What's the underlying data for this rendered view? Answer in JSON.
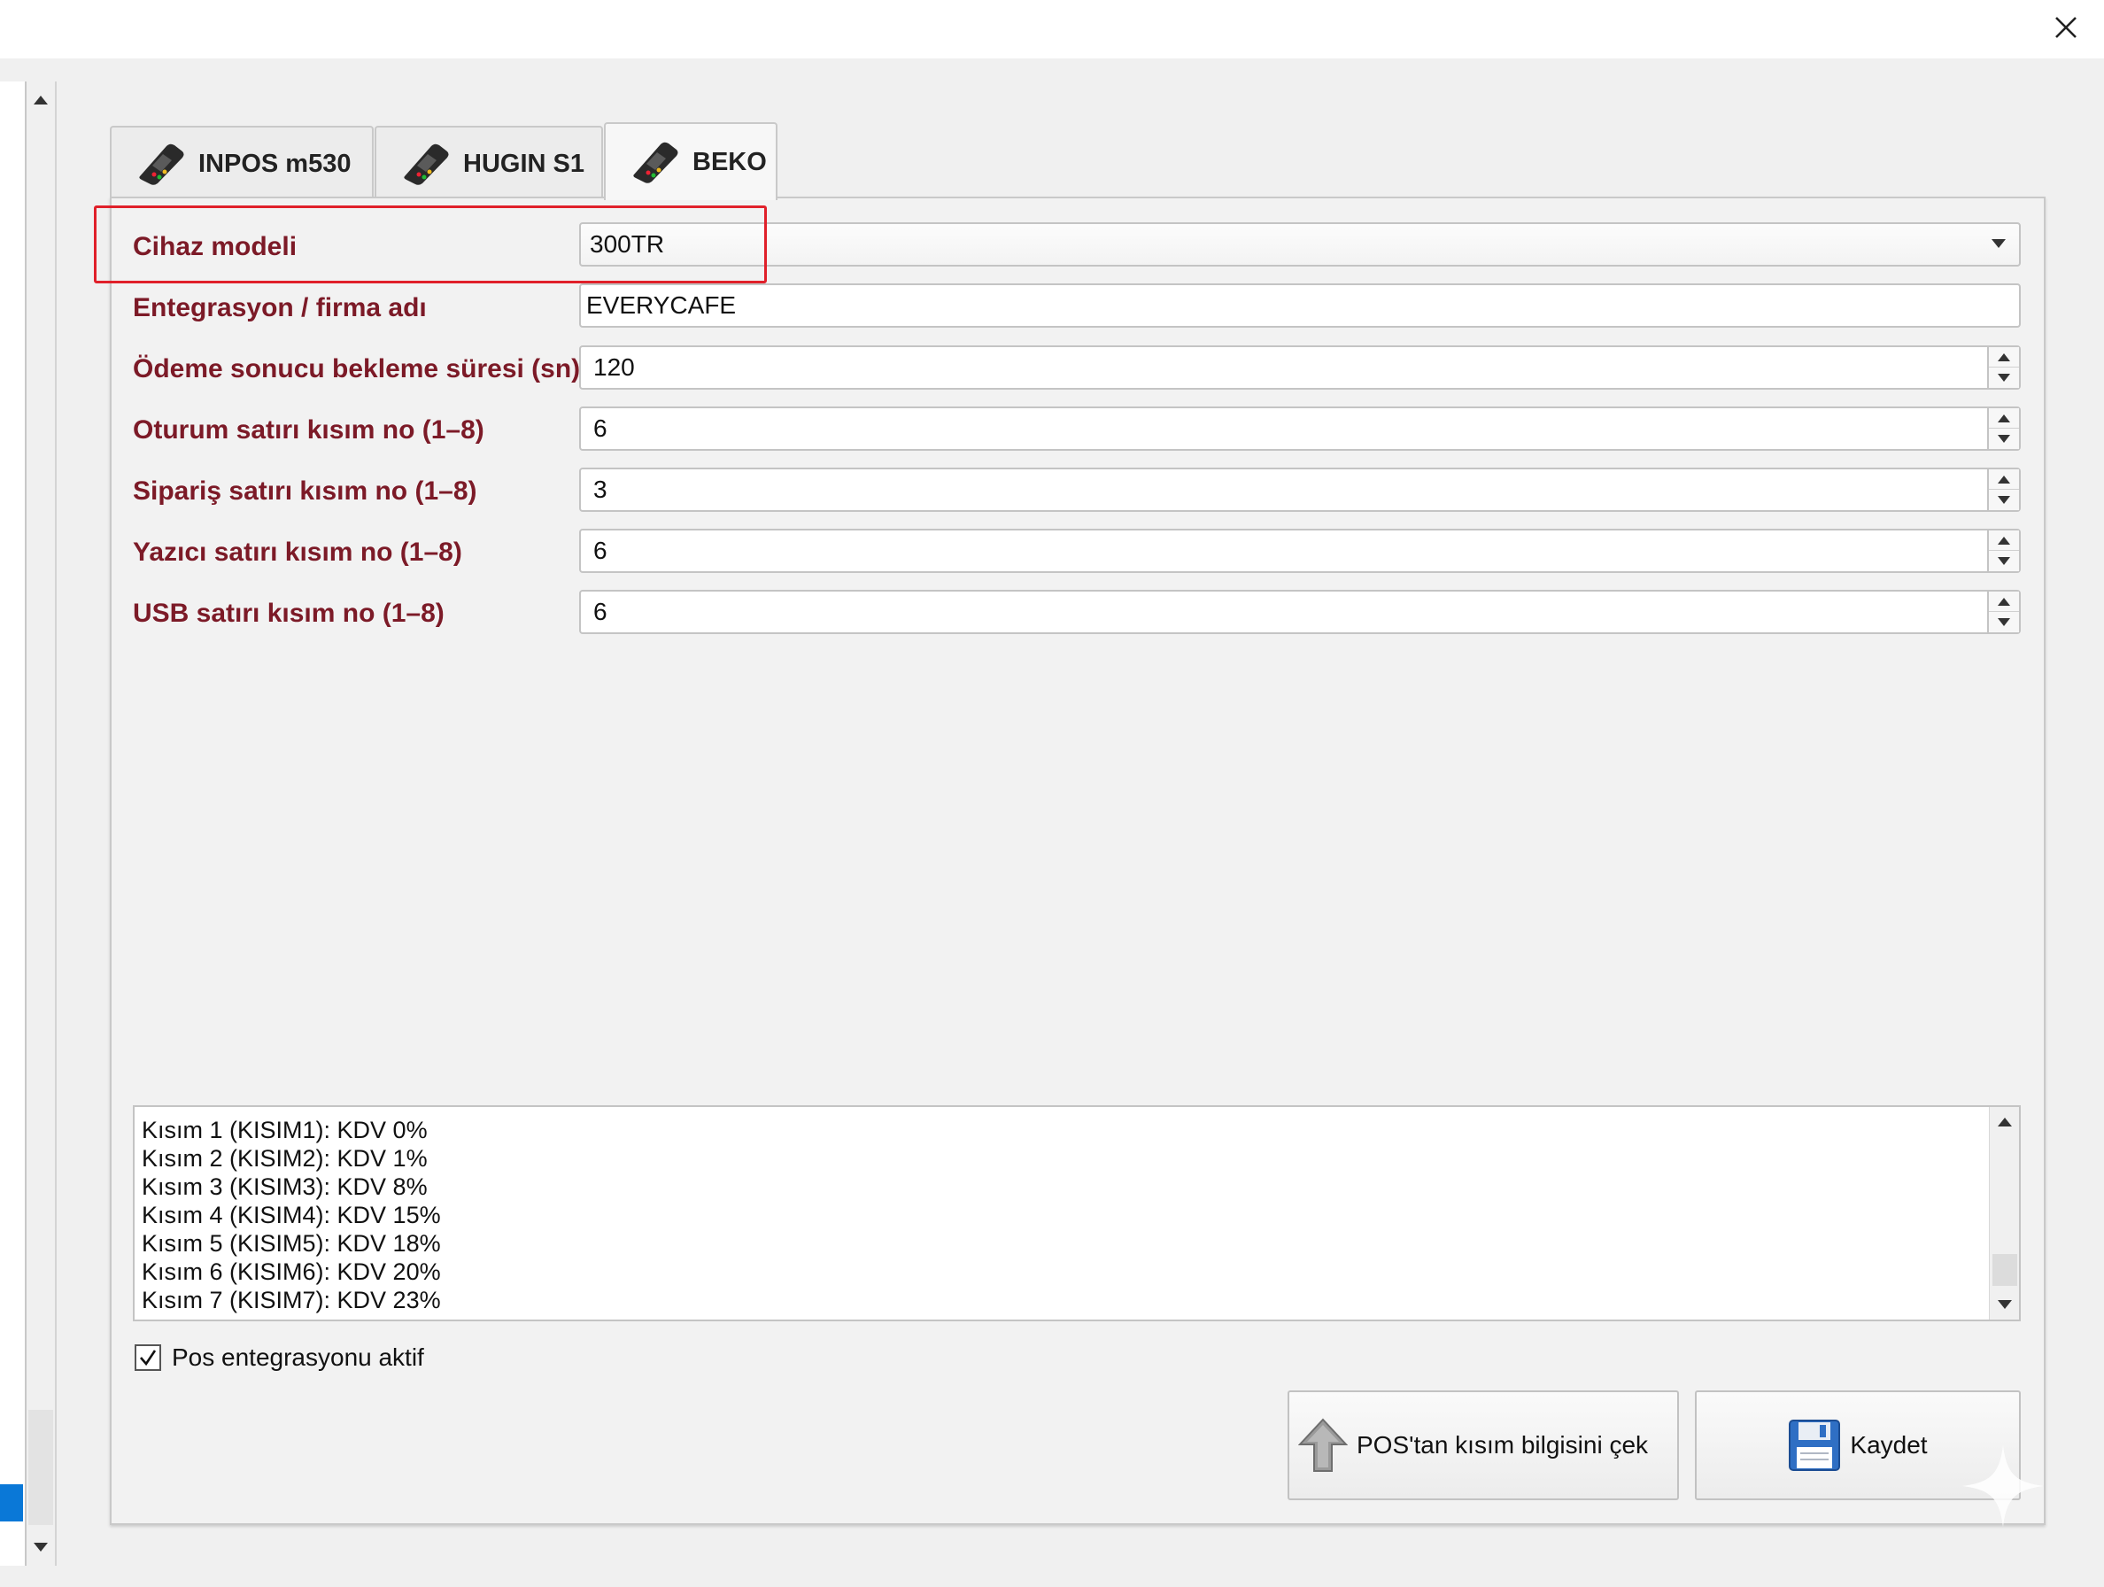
{
  "window": {
    "close_label": "Close"
  },
  "tabs": [
    {
      "label": "INPOS m530",
      "active": false
    },
    {
      "label": "HUGIN S1",
      "active": false
    },
    {
      "label": "BEKO",
      "active": true
    }
  ],
  "form": {
    "device_model": {
      "label": "Cihaz modeli",
      "value": "300TR"
    },
    "integration_name": {
      "label": "Entegrasyon / firma adı",
      "value": "EVERYCAFE"
    },
    "payment_timeout": {
      "label": "Ödeme sonucu bekleme süresi (sn)",
      "value": "120"
    },
    "session_dept": {
      "label": "Oturum satırı kısım no (1–8)",
      "value": "6"
    },
    "order_dept": {
      "label": "Sipariş satırı kısım no (1–8)",
      "value": "3"
    },
    "printer_dept": {
      "label": "Yazıcı satırı kısım no (1–8)",
      "value": "6"
    },
    "usb_dept": {
      "label": "USB satırı kısım no (1–8)",
      "value": "6"
    }
  },
  "departments": [
    "Kısım 1 (KISIM1): KDV 0%",
    "Kısım 2 (KISIM2): KDV 1%",
    "Kısım 3 (KISIM3): KDV 8%",
    "Kısım 4 (KISIM4): KDV 15%",
    "Kısım 5 (KISIM5): KDV 18%",
    "Kısım 6 (KISIM6): KDV 20%",
    "Kısım 7 (KISIM7): KDV 23%"
  ],
  "pos_active": {
    "label": "Pos entegrasyonu aktif",
    "checked": true
  },
  "buttons": {
    "pull_label": "POS'tan kısım bilgisini çek",
    "save_label": "Kaydet"
  },
  "colors": {
    "label": "#7c1a27",
    "highlight": "#e0202a",
    "selection": "#0a78d7"
  }
}
